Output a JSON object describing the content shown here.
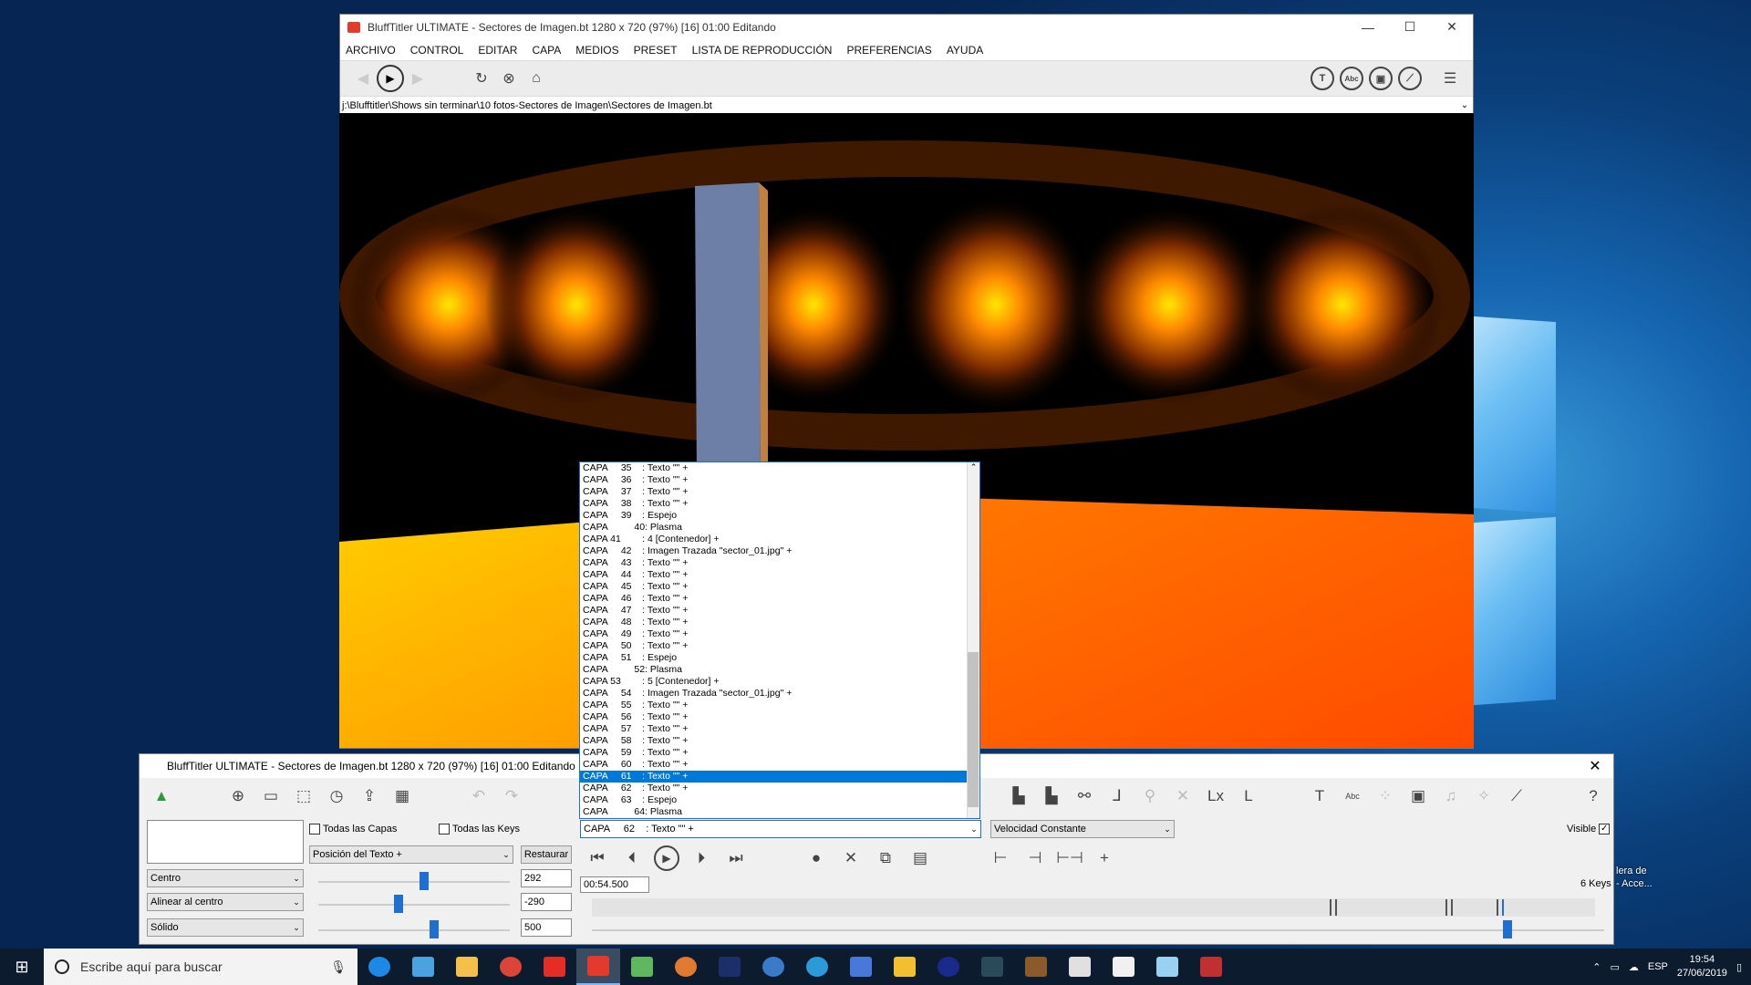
{
  "main_window": {
    "title": "BluffTitler ULTIMATE  - Sectores de Imagen.bt 1280 x 720 (97%) [16] 01:00 Editando",
    "controls": {
      "minimize": "—",
      "maximize": "☐",
      "close": "✕"
    },
    "menu": [
      "ARCHIVO",
      "CONTROL",
      "EDITAR",
      "CAPA",
      "MEDIOS",
      "PRESET",
      "LISTA DE REPRODUCCIÓN",
      "PREFERENCIAS",
      "AYUDA"
    ],
    "path": "j:\\Blufftitler\\Shows sin terminar\\10 fotos-Sectores de Imagen\\Sectores de Imagen.bt"
  },
  "panel": {
    "title": "BluffTitler ULTIMATE  - Sectores de Imagen.bt 1280 x 720 (97%) [16] 01:00 Editando",
    "todas_capas": "Todas las Capas",
    "todas_keys": "Todas las Keys",
    "property_select": "Posición del Texto +",
    "restore": "Restaurar",
    "align_h": "Centro",
    "align_v": "Alinear al centro",
    "style": "Sólido",
    "value_x": "292",
    "value_y": "-290",
    "value_z": "500",
    "layer_select": "CAPA     62    : Texto \"\" +",
    "speed_select": "Velocidad Constante",
    "visible": "Visible",
    "time": "00:54.500",
    "keys": "6 Keys"
  },
  "layer_list": [
    "CAPA     35    : Texto \"\" +",
    "CAPA     36    : Texto \"\" +",
    "CAPA     37    : Texto \"\" +",
    "CAPA     38    : Texto \"\" +",
    "CAPA     39    : Espejo",
    "CAPA          40: Plasma",
    "CAPA 41        : 4 [Contenedor] +",
    "CAPA     42    : Imagen Trazada \"sector_01.jpg\" +",
    "CAPA     43    : Texto \"\" +",
    "CAPA     44    : Texto \"\" +",
    "CAPA     45    : Texto \"\" +",
    "CAPA     46    : Texto \"\" +",
    "CAPA     47    : Texto \"\" +",
    "CAPA     48    : Texto \"\" +",
    "CAPA     49    : Texto \"\" +",
    "CAPA     50    : Texto \"\" +",
    "CAPA     51    : Espejo",
    "CAPA          52: Plasma",
    "CAPA 53        : 5 [Contenedor] +",
    "CAPA     54    : Imagen Trazada \"sector_01.jpg\" +",
    "CAPA     55    : Texto \"\" +",
    "CAPA     56    : Texto \"\" +",
    "CAPA     57    : Texto \"\" +",
    "CAPA     58    : Texto \"\" +",
    "CAPA     59    : Texto \"\" +",
    "CAPA     60    : Texto \"\" +",
    "CAPA     61    : Texto \"\" +",
    "CAPA     62    : Texto \"\" +",
    "CAPA     63    : Espejo",
    "CAPA          64: Plasma"
  ],
  "selected_layer_index": 26,
  "taskbar": {
    "search_placeholder": "Escribe aquí para buscar",
    "lang": "ESP",
    "time": "19:54",
    "date": "27/06/2019"
  },
  "desktop_icon_text": [
    "lera de",
    "- Acce..."
  ],
  "colors": {
    "accent": "#0078d7",
    "taskbar": "#0d1b2e",
    "glow": "#ffb000"
  }
}
